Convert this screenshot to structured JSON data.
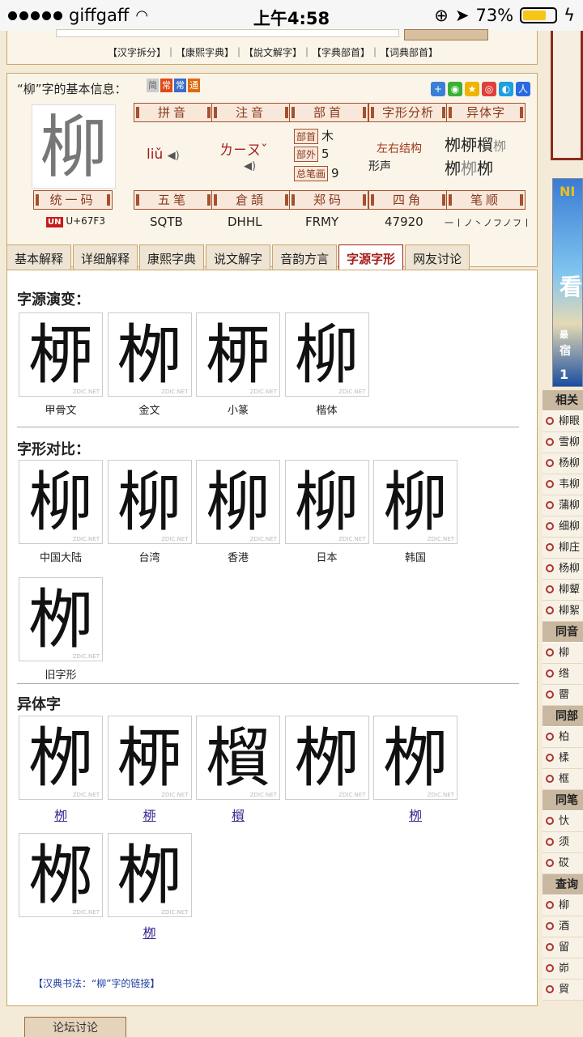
{
  "status": {
    "carrier": "giffgaff",
    "time": "上午4:58",
    "battery_text": "73%",
    "battery_level": 0.73
  },
  "toplinks": "【汉字拆分】｜【康熙字典】｜【說文解字】｜【字典部首】｜【词典部首】",
  "info": {
    "title": "“柳”字的基本信息：",
    "char": "柳",
    "tags_small": [
      "简",
      "常",
      "常",
      "通"
    ],
    "labels": {
      "pinyin": "拼音",
      "zhuyin": "注音",
      "bushou": "部首",
      "zixing": "字形分析",
      "yiti": "异体字",
      "tongyi": "统一码",
      "wubi": "五笔",
      "cangjie": "倉頡",
      "zhengma": "郑码",
      "sijiao": "四角",
      "bishun": "笔顺"
    },
    "pinyin": "liǔ",
    "zhuyin": "ㄌㄧㄡˇ",
    "bushou_tag": "部首",
    "bushou_val": "木",
    "buwai_tag": "部外",
    "buwai_val": "5",
    "zongbi_tag": "总笔画",
    "zongbi_val": "9",
    "structure": "左右结构",
    "formation": "形声",
    "variants_small": [
      "栁",
      "桺",
      "橮",
      "栁",
      "栁",
      "栁"
    ],
    "unicode": "U+67F3",
    "wubi": "SQTB",
    "cangjie": "DHHL",
    "zhengma": "FRMY",
    "sijiao": "47920",
    "bishun": "一丨ノ丶ノフノフ丨"
  },
  "tabs": [
    "基本解释",
    "详细解释",
    "康熙字典",
    "说文解字",
    "音韵方言",
    "字源字形",
    "网友讨论"
  ],
  "content": {
    "s1": "字源演变：",
    "s2": "字形对比：",
    "s3": "异体字",
    "evolution": [
      {
        "c": "桺",
        "cap": "甲骨文"
      },
      {
        "c": "栁",
        "cap": "金文"
      },
      {
        "c": "桺",
        "cap": "小篆"
      },
      {
        "c": "柳",
        "cap": "楷体"
      }
    ],
    "compare": [
      {
        "c": "柳",
        "cap": "中国大陆"
      },
      {
        "c": "柳",
        "cap": "台湾"
      },
      {
        "c": "柳",
        "cap": "香港"
      },
      {
        "c": "柳",
        "cap": "日本"
      },
      {
        "c": "柳",
        "cap": "韩国"
      },
      {
        "c": "栁",
        "cap": "旧字形"
      }
    ],
    "variants": [
      {
        "c": "栁",
        "cap": "栁"
      },
      {
        "c": "桺",
        "cap": "桺"
      },
      {
        "c": "橮",
        "cap": "橮"
      },
      {
        "c": "栁",
        "cap": ""
      },
      {
        "c": "栁",
        "cap": "栁"
      },
      {
        "c": "桞",
        "cap": ""
      },
      {
        "c": "栁",
        "cap": "栁"
      }
    ],
    "watermark": "ZDIC.NET",
    "bottom_link": "【汉典书法：“柳”字的链接】"
  },
  "forum": "论坛讨论",
  "right": {
    "ad_top": "NI",
    "ad_mid": "看",
    "ad_small1": "最",
    "ad_small2": "宿",
    "ad_bottom": "1",
    "groups": [
      {
        "h": "相关",
        "items": [
          "柳眼",
          "雪柳",
          "杨柳",
          "韦柳",
          "蒲柳",
          "细柳",
          "柳庄",
          "杨柳",
          "柳颦",
          "柳絮"
        ]
      },
      {
        "h": "同音",
        "items": [
          "柳",
          "绺",
          "罶"
        ]
      },
      {
        "h": "同部",
        "items": [
          "柏",
          "楺",
          "框"
        ]
      },
      {
        "h": "同笔",
        "items": [
          "忕",
          "须",
          "砹"
        ]
      },
      {
        "h": "查询",
        "items": [
          "柳",
          "酒",
          "留",
          "峁",
          "貿"
        ]
      }
    ]
  }
}
